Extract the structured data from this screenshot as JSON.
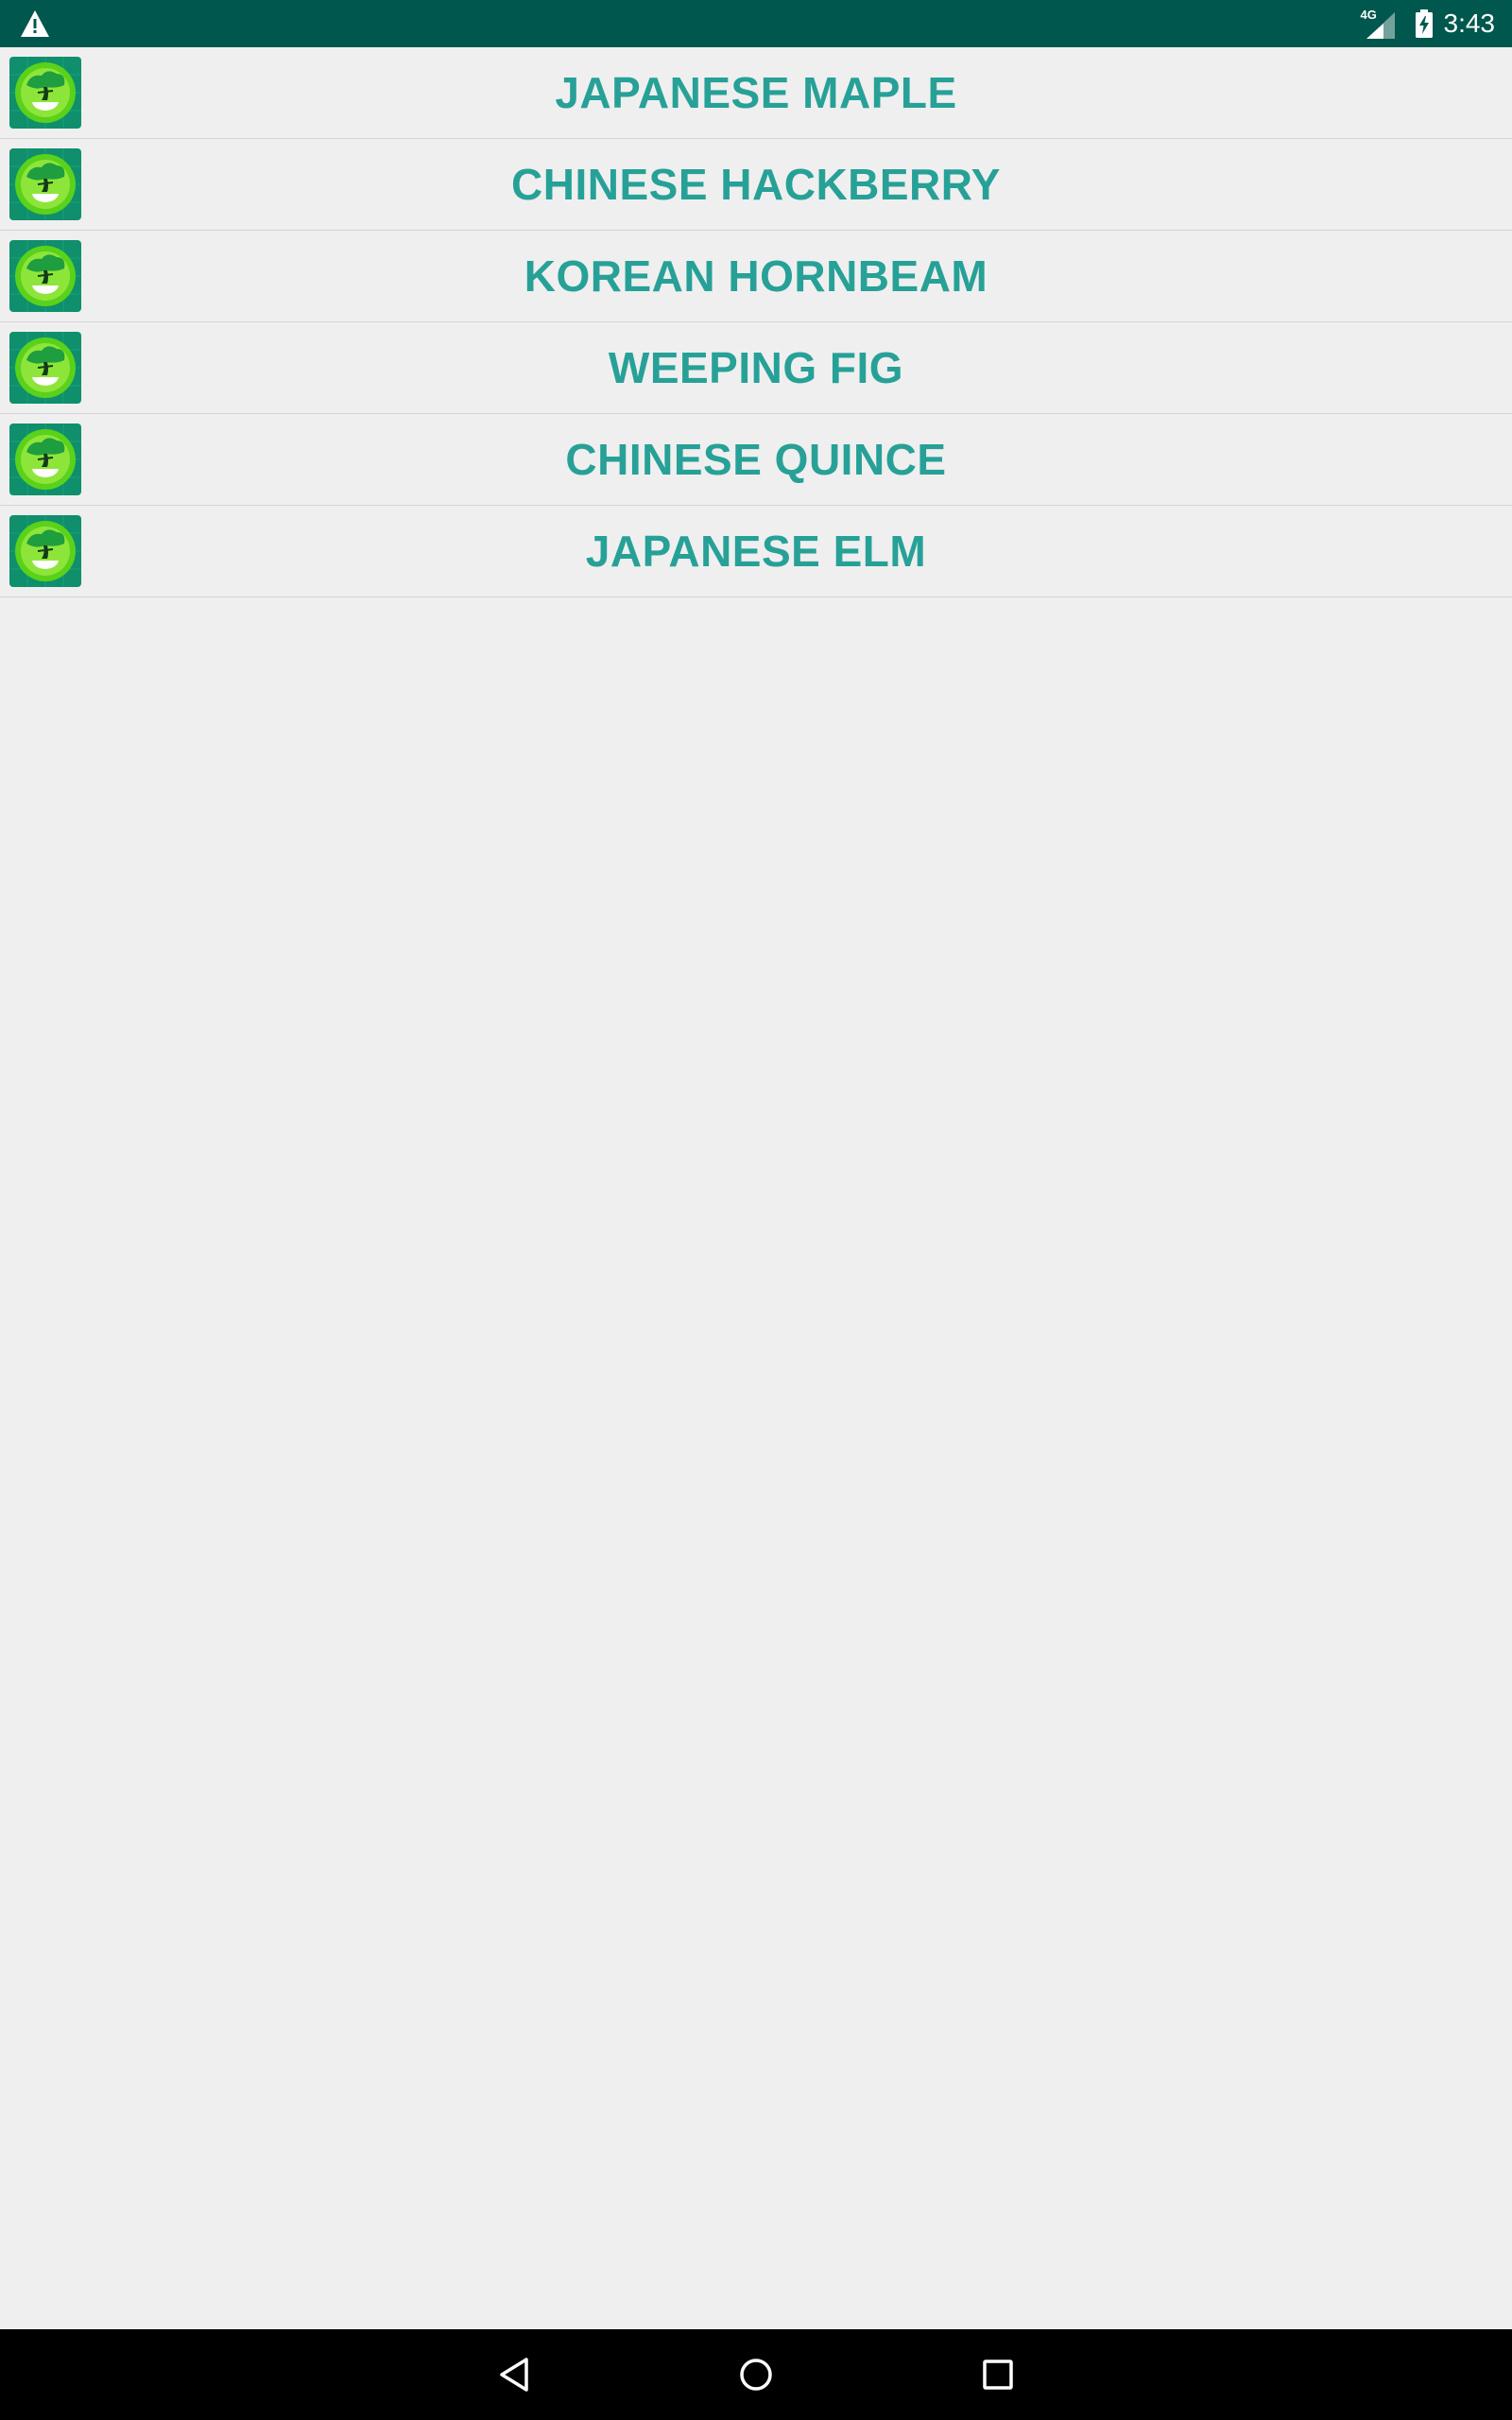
{
  "status_bar": {
    "network_label": "4G",
    "time": "3:43",
    "icons": [
      "warning-icon",
      "signal-icon",
      "battery-charging-icon"
    ],
    "background_color": "#00574d"
  },
  "plant_list": {
    "text_color": "#27a197",
    "item_icon": "bonsai-icon",
    "items": [
      {
        "label": "JAPANESE MAPLE"
      },
      {
        "label": "CHINESE HACKBERRY"
      },
      {
        "label": "KOREAN HORNBEAM"
      },
      {
        "label": "WEEPING FIG"
      },
      {
        "label": "CHINESE QUINCE"
      },
      {
        "label": "JAPANESE ELM"
      }
    ]
  },
  "nav_bar": {
    "icons": [
      "back-icon",
      "home-icon",
      "recents-icon"
    ],
    "background_color": "#000000"
  }
}
